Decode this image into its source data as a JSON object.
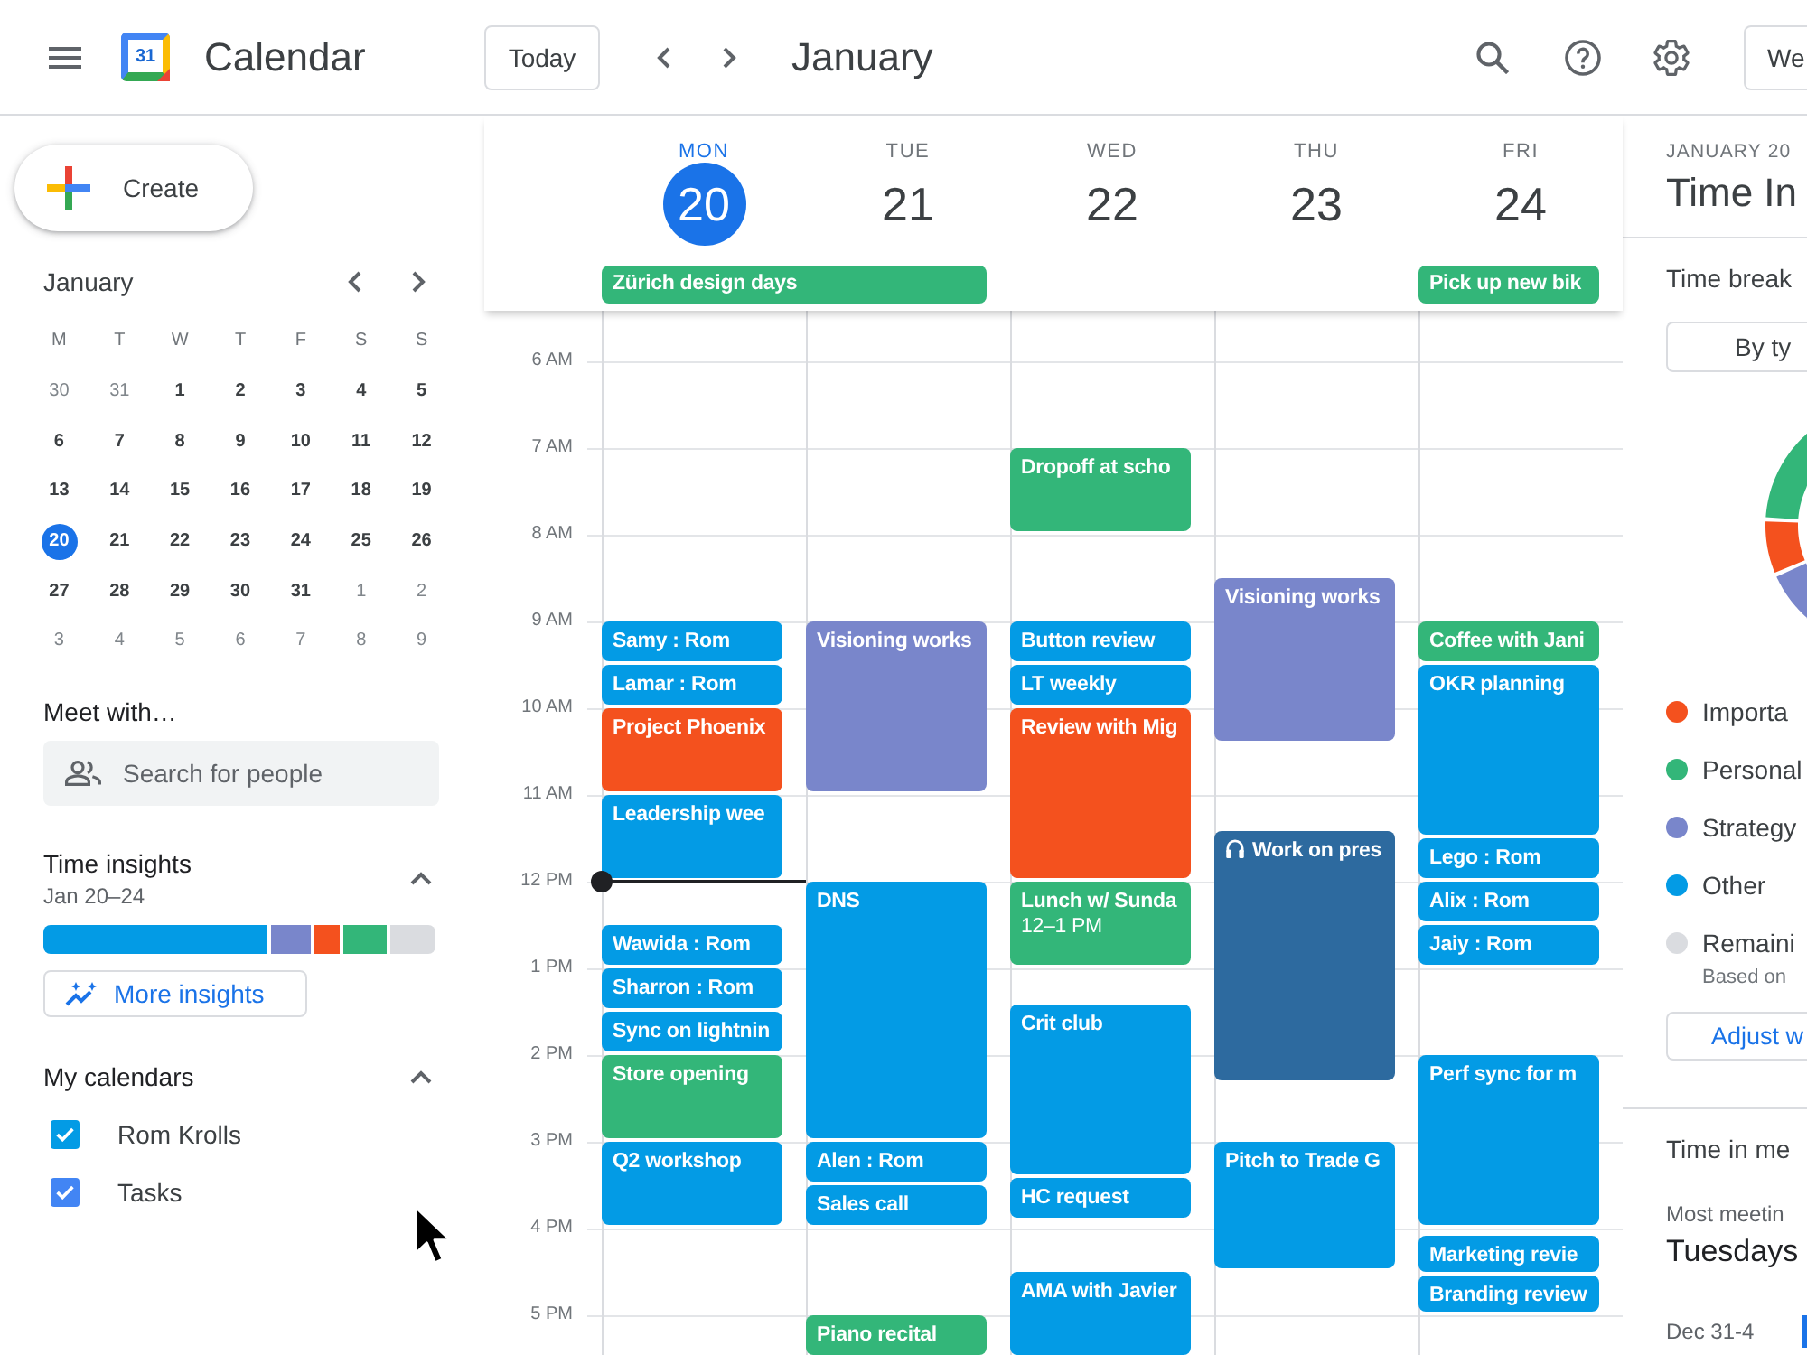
{
  "topbar": {
    "logo_text": "31",
    "title": "Calendar",
    "today_button": "Today",
    "month": "January",
    "view_button": "We"
  },
  "sidebar": {
    "create_button": "Create",
    "mini_calendar": {
      "month": "January",
      "weekdays": [
        "M",
        "T",
        "W",
        "T",
        "F",
        "S",
        "S"
      ],
      "weeks": [
        [
          {
            "day": "30",
            "other_month": true,
            "selected": false
          },
          {
            "day": "31",
            "other_month": true,
            "selected": false
          },
          {
            "day": "1",
            "other_month": false,
            "selected": false
          },
          {
            "day": "2",
            "other_month": false,
            "selected": false
          },
          {
            "day": "3",
            "other_month": false,
            "selected": false
          },
          {
            "day": "4",
            "other_month": false,
            "selected": false
          },
          {
            "day": "5",
            "other_month": false,
            "selected": false
          }
        ],
        [
          {
            "day": "6",
            "other_month": false,
            "selected": false
          },
          {
            "day": "7",
            "other_month": false,
            "selected": false
          },
          {
            "day": "8",
            "other_month": false,
            "selected": false
          },
          {
            "day": "9",
            "other_month": false,
            "selected": false
          },
          {
            "day": "10",
            "other_month": false,
            "selected": false
          },
          {
            "day": "11",
            "other_month": false,
            "selected": false
          },
          {
            "day": "12",
            "other_month": false,
            "selected": false
          }
        ],
        [
          {
            "day": "13",
            "other_month": false,
            "selected": false
          },
          {
            "day": "14",
            "other_month": false,
            "selected": false
          },
          {
            "day": "15",
            "other_month": false,
            "selected": false
          },
          {
            "day": "16",
            "other_month": false,
            "selected": false
          },
          {
            "day": "17",
            "other_month": false,
            "selected": false
          },
          {
            "day": "18",
            "other_month": false,
            "selected": false
          },
          {
            "day": "19",
            "other_month": false,
            "selected": false
          }
        ],
        [
          {
            "day": "20",
            "other_month": false,
            "selected": true
          },
          {
            "day": "21",
            "other_month": false,
            "selected": false
          },
          {
            "day": "22",
            "other_month": false,
            "selected": false
          },
          {
            "day": "23",
            "other_month": false,
            "selected": false
          },
          {
            "day": "24",
            "other_month": false,
            "selected": false
          },
          {
            "day": "25",
            "other_month": false,
            "selected": false
          },
          {
            "day": "26",
            "other_month": false,
            "selected": false
          }
        ],
        [
          {
            "day": "27",
            "other_month": false,
            "selected": false
          },
          {
            "day": "28",
            "other_month": false,
            "selected": false
          },
          {
            "day": "29",
            "other_month": false,
            "selected": false
          },
          {
            "day": "30",
            "other_month": false,
            "selected": false
          },
          {
            "day": "31",
            "other_month": false,
            "selected": false
          },
          {
            "day": "1",
            "other_month": true,
            "selected": false
          },
          {
            "day": "2",
            "other_month": true,
            "selected": false
          }
        ],
        [
          {
            "day": "3",
            "other_month": true,
            "selected": false
          },
          {
            "day": "4",
            "other_month": true,
            "selected": false
          },
          {
            "day": "5",
            "other_month": true,
            "selected": false
          },
          {
            "day": "6",
            "other_month": true,
            "selected": false
          },
          {
            "day": "7",
            "other_month": true,
            "selected": false
          },
          {
            "day": "8",
            "other_month": true,
            "selected": false
          },
          {
            "day": "9",
            "other_month": true,
            "selected": false
          }
        ]
      ]
    },
    "meet_with": {
      "heading": "Meet with…",
      "search": {
        "placeholder": "Search for people"
      }
    },
    "time_insights": {
      "heading": "Time insights",
      "range": "Jan 20–24",
      "expanded": true,
      "segments": [
        {
          "color": "#039be5"
        },
        {
          "color": "#7986cb"
        },
        {
          "color": "#f4511e"
        },
        {
          "color": "#33b679"
        },
        {
          "color": "#dadce0"
        }
      ],
      "button": "More insights"
    },
    "my_calendars": {
      "heading": "My calendars",
      "expanded": true,
      "items": [
        {
          "label": "Rom Krolls",
          "checked": true,
          "color": "#039be5"
        },
        {
          "label": "Tasks",
          "checked": true,
          "color": "#4285f4"
        }
      ]
    }
  },
  "grid": {
    "hours": [
      "6 AM",
      "7 AM",
      "8 AM",
      "9 AM",
      "10 AM",
      "11 AM",
      "12 PM",
      "1 PM",
      "2 PM",
      "3 PM",
      "4 PM",
      "5 PM"
    ],
    "days": [
      {
        "weekday": "MON",
        "date": "20",
        "today": true,
        "all_day": [
          {
            "title": "Zürich design days",
            "color": "#33b679",
            "continues": true
          }
        ],
        "events": [
          {
            "title": "Samy : Rom",
            "kind": "event",
            "color": "#039be5"
          },
          {
            "title": "Lamar : Rom",
            "kind": "event",
            "color": "#039be5"
          },
          {
            "title": "Project Phoenix",
            "kind": "event",
            "color": "#f4511e"
          },
          {
            "title": "Leadership wee",
            "kind": "event",
            "color": "#039be5"
          },
          {
            "title": "Wawida : Rom",
            "kind": "event",
            "color": "#039be5"
          },
          {
            "title": "Sharron : Rom",
            "kind": "event",
            "color": "#039be5"
          },
          {
            "title": "Sync on lightnin",
            "kind": "event",
            "color": "#039be5"
          },
          {
            "title": "Store opening",
            "kind": "event",
            "color": "#33b679"
          },
          {
            "title": "Q2 workshop",
            "kind": "event",
            "color": "#039be5"
          }
        ]
      },
      {
        "weekday": "TUE",
        "date": "21",
        "today": false,
        "events": [
          {
            "title": "Visioning works",
            "kind": "event",
            "color": "#7986cb"
          },
          {
            "title": "DNS",
            "kind": "event",
            "color": "#039be5"
          },
          {
            "title": "Alen : Rom",
            "kind": "event",
            "color": "#039be5"
          },
          {
            "title": "Sales call",
            "kind": "event",
            "color": "#039be5"
          },
          {
            "title": "Piano recital",
            "kind": "event",
            "color": "#33b679"
          }
        ]
      },
      {
        "weekday": "WED",
        "date": "22",
        "today": false,
        "events": [
          {
            "title": "Dropoff at scho",
            "kind": "event",
            "color": "#33b679"
          },
          {
            "title": "Button review",
            "kind": "event",
            "color": "#039be5"
          },
          {
            "title": "LT weekly",
            "kind": "event",
            "color": "#039be5"
          },
          {
            "title": "Review with Mig",
            "kind": "event",
            "color": "#f4511e"
          },
          {
            "title": "Lunch w/ Sunda",
            "kind": "event",
            "color": "#33b679",
            "time": "12–1 PM"
          },
          {
            "title": "Crit club",
            "kind": "event",
            "color": "#039be5"
          },
          {
            "title": "HC request",
            "kind": "event",
            "color": "#039be5"
          },
          {
            "title": "AMA with Javier",
            "kind": "event",
            "color": "#039be5"
          }
        ]
      },
      {
        "weekday": "THU",
        "date": "23",
        "today": false,
        "events": [
          {
            "title": "Visioning works",
            "kind": "event",
            "color": "#7986cb"
          },
          {
            "title": "Work on pres",
            "kind": "focus",
            "color": "#2d6a9f"
          },
          {
            "title": "Pitch to Trade G",
            "kind": "event",
            "color": "#039be5"
          }
        ]
      },
      {
        "weekday": "FRI",
        "date": "24",
        "today": false,
        "all_day": [
          {
            "title": "Pick up new bik",
            "color": "#33b679",
            "continues": false
          }
        ],
        "events": [
          {
            "title": "Coffee with Jani",
            "kind": "event",
            "color": "#33b679"
          },
          {
            "title": "OKR planning",
            "kind": "event",
            "color": "#039be5"
          },
          {
            "title": "Lego : Rom",
            "kind": "event",
            "color": "#039be5"
          },
          {
            "title": "Alix : Rom",
            "kind": "event",
            "color": "#039be5"
          },
          {
            "title": "Jaiy : Rom",
            "kind": "event",
            "color": "#039be5"
          },
          {
            "title": "Perf sync for m",
            "kind": "event",
            "color": "#039be5"
          },
          {
            "title": "Marketing revie",
            "kind": "event",
            "color": "#039be5"
          },
          {
            "title": "Branding review",
            "kind": "event",
            "color": "#039be5"
          }
        ]
      }
    ]
  },
  "insights_panel": {
    "date_range": "JANUARY 20",
    "title": "Time In",
    "breakdown": {
      "heading": "Time break",
      "dropdown": "By ty",
      "legend": [
        {
          "label": "Importa",
          "color": "#f4511e"
        },
        {
          "label": "Personal",
          "color": "#33b679"
        },
        {
          "label": "Strategy",
          "color": "#7986cb"
        },
        {
          "label": "Other",
          "color": "#039be5"
        },
        {
          "label": "Remaini",
          "color": "#dadce0",
          "note": "Based on"
        }
      ],
      "button": "Adjust w"
    },
    "meetings": {
      "heading": "Time in me",
      "caption": "Most meetin",
      "value": "Tuesdays",
      "weeks": [
        {
          "label": "Dec 31-4"
        }
      ]
    }
  }
}
